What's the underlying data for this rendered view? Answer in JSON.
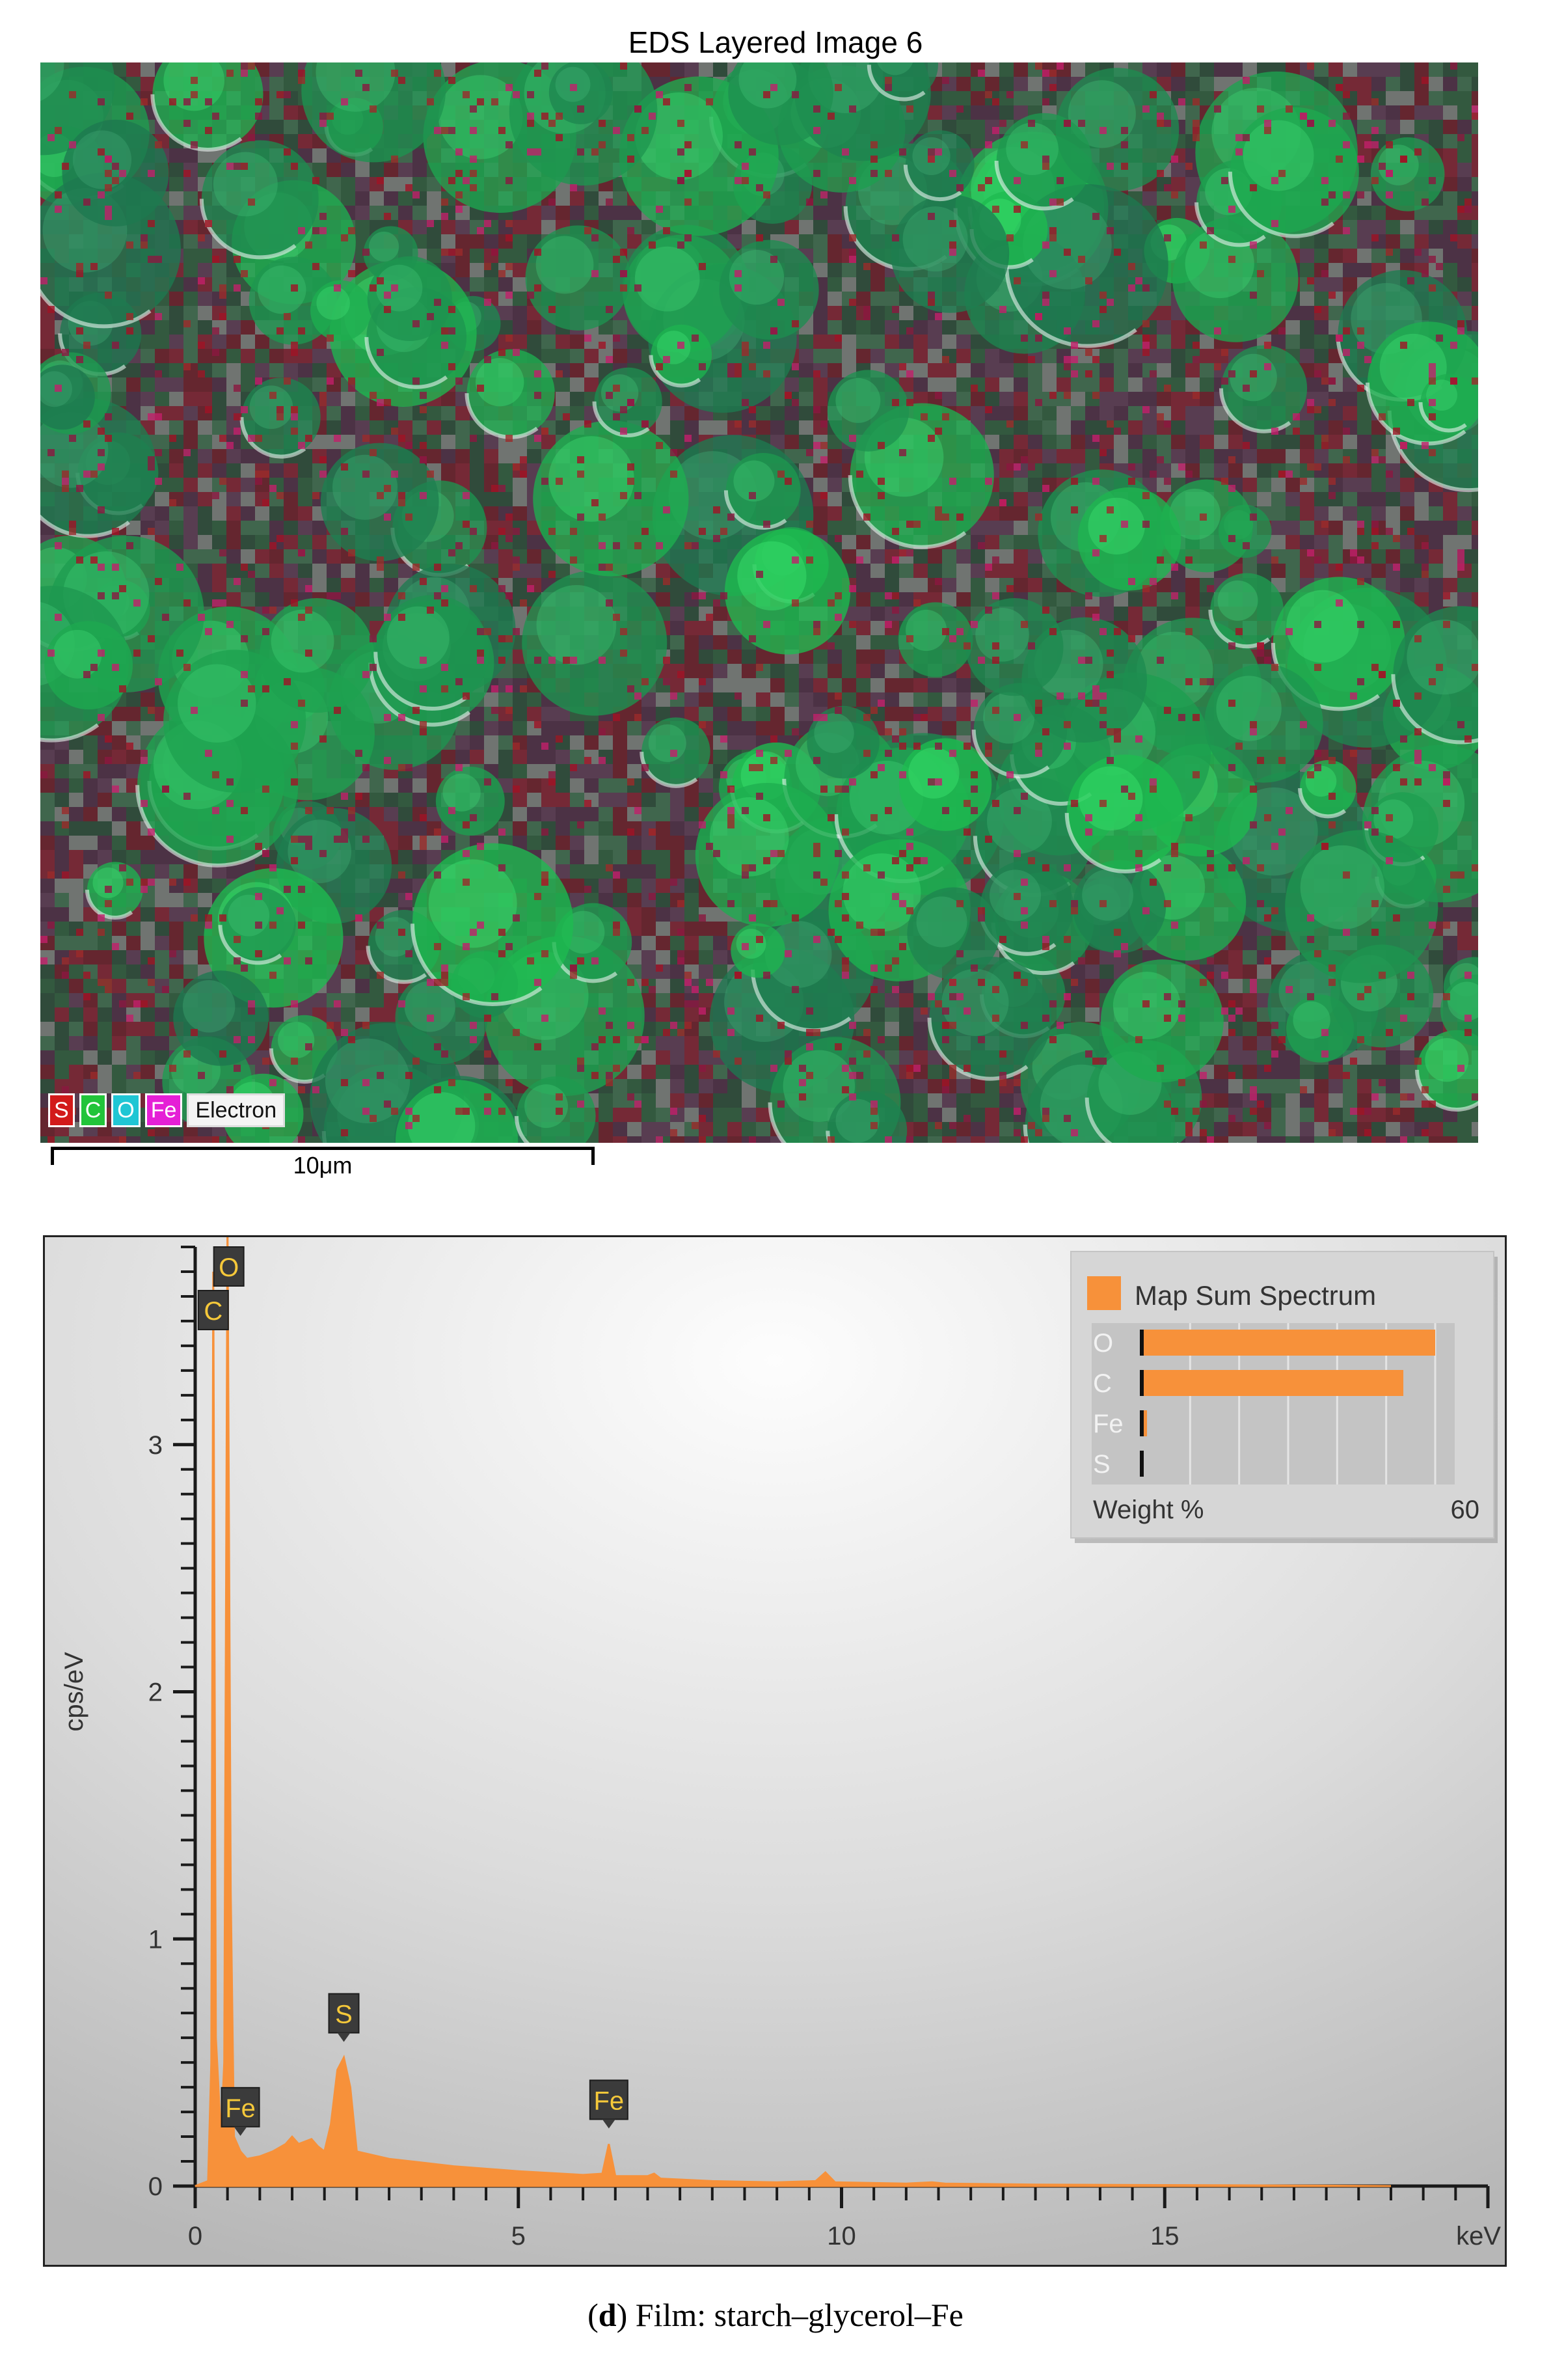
{
  "image": {
    "title": "EDS Layered Image 6",
    "element_legend": [
      {
        "label": "S",
        "color": "#d21a1a"
      },
      {
        "label": "C",
        "color": "#22c43a"
      },
      {
        "label": "O",
        "color": "#1fc6d4"
      },
      {
        "label": "Fe",
        "color": "#e51fd6"
      },
      {
        "label": "Electron",
        "color": "#f4f4f4"
      }
    ],
    "scale_bar": "10μm"
  },
  "chart_data": {
    "type": "line",
    "xlabel": "keV",
    "ylabel": "cps/eV",
    "xlim": [
      0,
      20
    ],
    "ylim": [
      0,
      3.8
    ],
    "x_ticks": [
      "0",
      "5",
      "10",
      "15"
    ],
    "y_ticks": [
      "0",
      "1",
      "2",
      "3"
    ],
    "series_color": "#f7913a",
    "spectrum": [
      [
        0.0,
        0.0
      ],
      [
        0.2,
        0.02
      ],
      [
        0.25,
        0.5
      ],
      [
        0.28,
        3.7
      ],
      [
        0.32,
        0.6
      ],
      [
        0.4,
        0.2
      ],
      [
        0.45,
        0.5
      ],
      [
        0.5,
        3.9
      ],
      [
        0.55,
        1.2
      ],
      [
        0.6,
        0.2
      ],
      [
        0.7,
        0.14
      ],
      [
        0.8,
        0.11
      ],
      [
        1.0,
        0.12
      ],
      [
        1.2,
        0.14
      ],
      [
        1.4,
        0.17
      ],
      [
        1.5,
        0.2
      ],
      [
        1.6,
        0.17
      ],
      [
        1.8,
        0.19
      ],
      [
        1.9,
        0.16
      ],
      [
        2.0,
        0.14
      ],
      [
        2.1,
        0.25
      ],
      [
        2.2,
        0.47
      ],
      [
        2.3,
        0.52
      ],
      [
        2.4,
        0.4
      ],
      [
        2.5,
        0.14
      ],
      [
        3.0,
        0.11
      ],
      [
        4.0,
        0.08
      ],
      [
        5.0,
        0.06
      ],
      [
        6.0,
        0.045
      ],
      [
        6.3,
        0.05
      ],
      [
        6.4,
        0.17
      ],
      [
        6.5,
        0.04
      ],
      [
        7.0,
        0.04
      ],
      [
        7.1,
        0.05
      ],
      [
        7.2,
        0.03
      ],
      [
        8.0,
        0.02
      ],
      [
        9.0,
        0.015
      ],
      [
        9.6,
        0.02
      ],
      [
        9.75,
        0.055
      ],
      [
        9.9,
        0.015
      ],
      [
        11.0,
        0.01
      ],
      [
        11.4,
        0.015
      ],
      [
        11.6,
        0.01
      ],
      [
        13.0,
        0.006
      ],
      [
        15.0,
        0.004
      ],
      [
        17.0,
        0.002
      ],
      [
        18.5,
        0.0
      ]
    ],
    "peak_labels": [
      {
        "label": "O",
        "x": 0.52,
        "y": 3.9
      },
      {
        "label": "C",
        "x": 0.28,
        "y": 3.7
      },
      {
        "label": "Fe",
        "x": 0.7,
        "y": 0.14
      },
      {
        "label": "S",
        "x": 2.3,
        "y": 0.52
      },
      {
        "label": "Fe",
        "x": 6.4,
        "y": 0.17
      }
    ],
    "inset": {
      "legend": "Map Sum Spectrum",
      "xlabel": "Weight %",
      "xmax_label": "60",
      "xmax": 60,
      "bars": [
        {
          "label": "O",
          "value": 60
        },
        {
          "label": "C",
          "value": 53.5
        },
        {
          "label": "Fe",
          "value": 1.2
        },
        {
          "label": "S",
          "value": 0.4
        }
      ]
    }
  },
  "caption": {
    "letter": "d",
    "text": ") Film: starch–glycerol–Fe",
    "open": "("
  }
}
